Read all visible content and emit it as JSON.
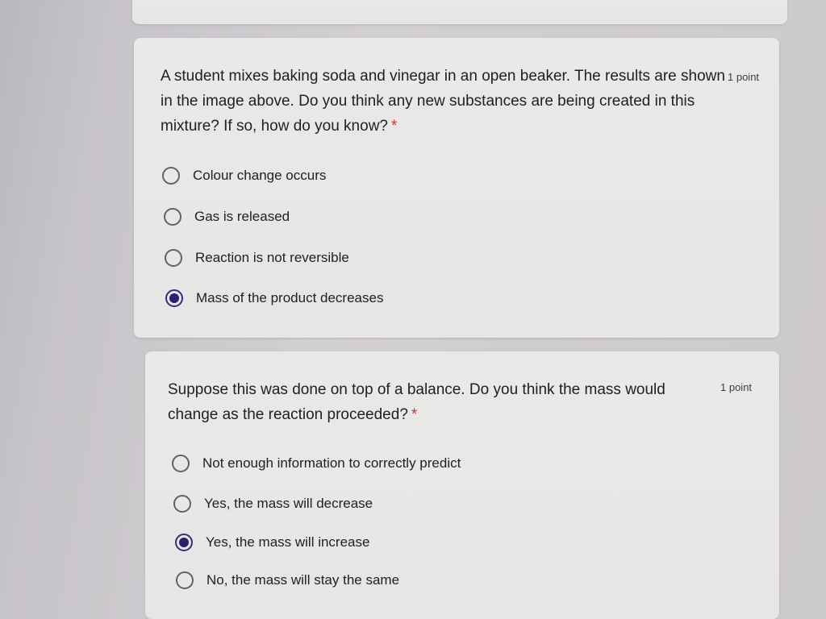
{
  "questions": [
    {
      "text": "A student mixes baking soda and vinegar in an open beaker. The results are shown in the image above. Do you think any new substances are being created in this mixture? If so, how do you know?",
      "required_mark": "*",
      "points": "1 point",
      "options": [
        {
          "label": "Colour change occurs",
          "selected": false
        },
        {
          "label": "Gas is released",
          "selected": false
        },
        {
          "label": "Reaction is not reversible",
          "selected": false
        },
        {
          "label": "Mass of the product decreases",
          "selected": true
        }
      ]
    },
    {
      "text": "Suppose this was done on top of a balance. Do you think the mass would change as the reaction proceeded?",
      "required_mark": "*",
      "points": "1 point",
      "options": [
        {
          "label": "Not enough information to correctly predict",
          "selected": false
        },
        {
          "label": "Yes, the mass will decrease",
          "selected": false
        },
        {
          "label": "Yes, the mass will increase",
          "selected": true
        },
        {
          "label": "No, the mass will stay the same",
          "selected": false
        }
      ]
    }
  ],
  "colors": {
    "radio_selected": "#2d1f6e",
    "required_star": "#d93025"
  }
}
